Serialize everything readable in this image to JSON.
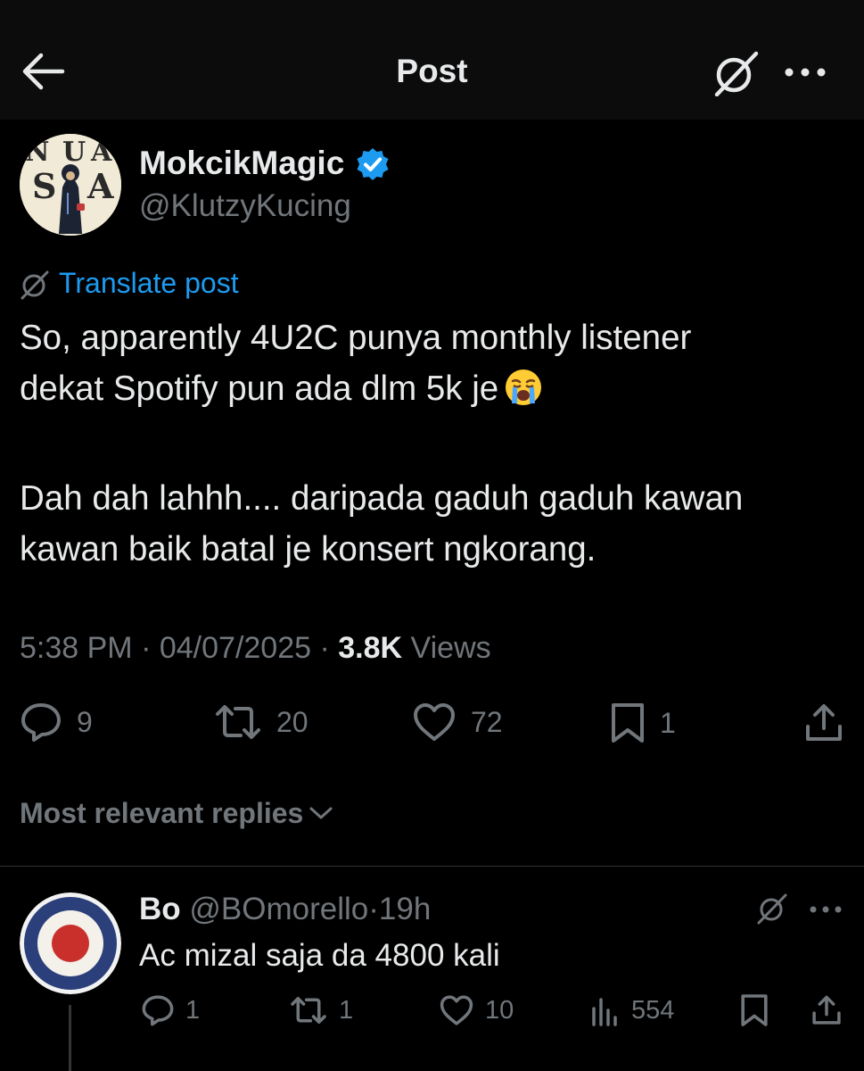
{
  "header": {
    "title": "Post",
    "back_icon": "arrow-left-icon",
    "grok_icon": "grok-icon",
    "more_icon": "more-horizontal-icon"
  },
  "post": {
    "author": {
      "name": "MokcikMagic",
      "handle": "@KlutzyKucing",
      "verified": true,
      "avatar_letters": [
        "N",
        "U",
        "A",
        "S",
        "A"
      ]
    },
    "translate_label": "Translate post",
    "text_lines": [
      "So, apparently 4U2C punya monthly listener",
      "dekat Spotify pun ada dlm 5k je",
      "Dah dah lahhh.... daripada gaduh gaduh kawan",
      "kawan baik batal je konsert ngkorang."
    ],
    "emoji": "loudly-crying-face",
    "time": "5:38 PM",
    "date": "04/07/2025",
    "separator": "·",
    "views_count": "3.8K",
    "views_label": "Views",
    "stats": {
      "replies": "9",
      "reposts": "20",
      "likes": "72",
      "bookmarks": "1"
    }
  },
  "replies_sort": {
    "label": "Most relevant replies"
  },
  "replies": [
    {
      "name": "Bo",
      "handle": "@BOmorello",
      "separator": "·",
      "age": "19h",
      "text": "Ac mizal saja da 4800 kali",
      "stats": {
        "replies": "1",
        "reposts": "1",
        "likes": "10",
        "views": "554"
      }
    }
  ],
  "colors": {
    "background": "#000000",
    "topbar": "#0c0c0c",
    "text_primary": "#e7e9ea",
    "text_secondary": "#71767b",
    "accent": "#1d9bf0",
    "divider": "#2f3336"
  }
}
